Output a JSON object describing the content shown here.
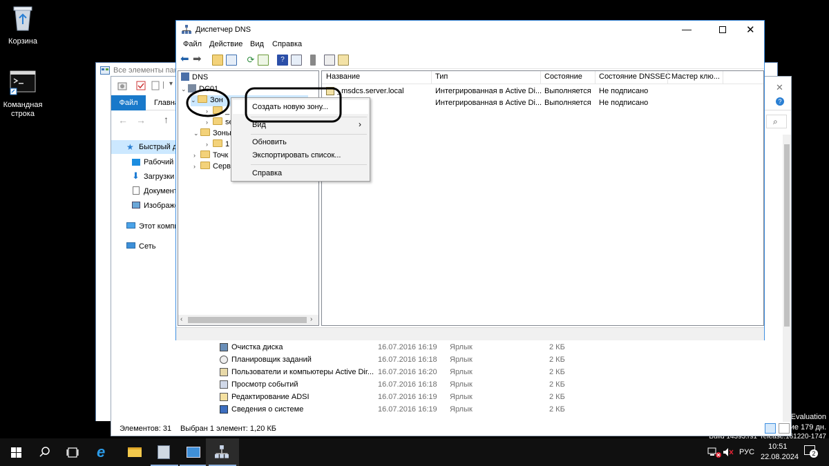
{
  "desktop": {
    "icons": [
      {
        "label": "Корзина"
      },
      {
        "label_line1": "Командная",
        "label_line2": "строка"
      }
    ],
    "watermark": {
      "line1": "Evaluation",
      "line2": "ие 179 дн.",
      "line3": "Build 14393.rs1_release.161220-1747"
    }
  },
  "control_panel_window": {
    "title": "Все элементы пане"
  },
  "explorer_window": {
    "ribbon_tabs": [
      "Файл",
      "Главна"
    ],
    "nav_items": [
      "Быстрый до",
      "Рабочий с",
      "Загрузки",
      "Документ",
      "Изображе",
      "Этот компь",
      "Сеть"
    ],
    "rows": [
      {
        "name": "Очистка диска",
        "date": "16.07.2016 16:19",
        "type": "Ярлык",
        "size": "2 КБ"
      },
      {
        "name": "Планировщик заданий",
        "date": "16.07.2016 16:18",
        "type": "Ярлык",
        "size": "2 КБ"
      },
      {
        "name": "Пользователи и компьютеры Active Dir...",
        "date": "16.07.2016 16:20",
        "type": "Ярлык",
        "size": "2 КБ"
      },
      {
        "name": "Просмотр событий",
        "date": "16.07.2016 16:18",
        "type": "Ярлык",
        "size": "2 КБ"
      },
      {
        "name": "Редактирование ADSI",
        "date": "16.07.2016 16:19",
        "type": "Ярлык",
        "size": "2 КБ"
      },
      {
        "name": "Сведения о системе",
        "date": "16.07.2016 16:19",
        "type": "Ярлык",
        "size": "2 КБ"
      }
    ],
    "status_count": "Элементов: 31",
    "status_selected": "Выбран 1 элемент: 1,20 КБ"
  },
  "dns_window": {
    "title": "Диспетчер DNS",
    "menu": [
      "Файл",
      "Действие",
      "Вид",
      "Справка"
    ],
    "tree": {
      "root": "DNS",
      "server": "DC01",
      "zone_selected": "Зон",
      "sub1": "_",
      "sub2": "se",
      "reverse": "Зоны",
      "reverse_sub": "1",
      "points": "Точк",
      "servers": "Серв"
    },
    "columns": [
      "Название",
      "Тип",
      "Состояние",
      "Состояние DNSSEC",
      "Мастер клю..."
    ],
    "rows": [
      {
        "name": "_msdcs.server.local",
        "type": "Интегрированная в Active Di...",
        "state": "Выполняется",
        "dnssec": "Не подписано"
      },
      {
        "name": "",
        "type": "Интегрированная в Active Di...",
        "state": "Выполняется",
        "dnssec": "Не подписано"
      }
    ],
    "context_menu": {
      "create_zone": "Создать новую зону...",
      "view": "Вид",
      "refresh": "Обновить",
      "export": "Экспортировать список...",
      "help": "Справка"
    }
  },
  "taskbar": {
    "lang": "РУС",
    "time": "10:51",
    "date": "22.08.2024",
    "notifications": "2"
  },
  "colors": {
    "accent": "#1979ca",
    "highlight_circle": "#000000"
  }
}
